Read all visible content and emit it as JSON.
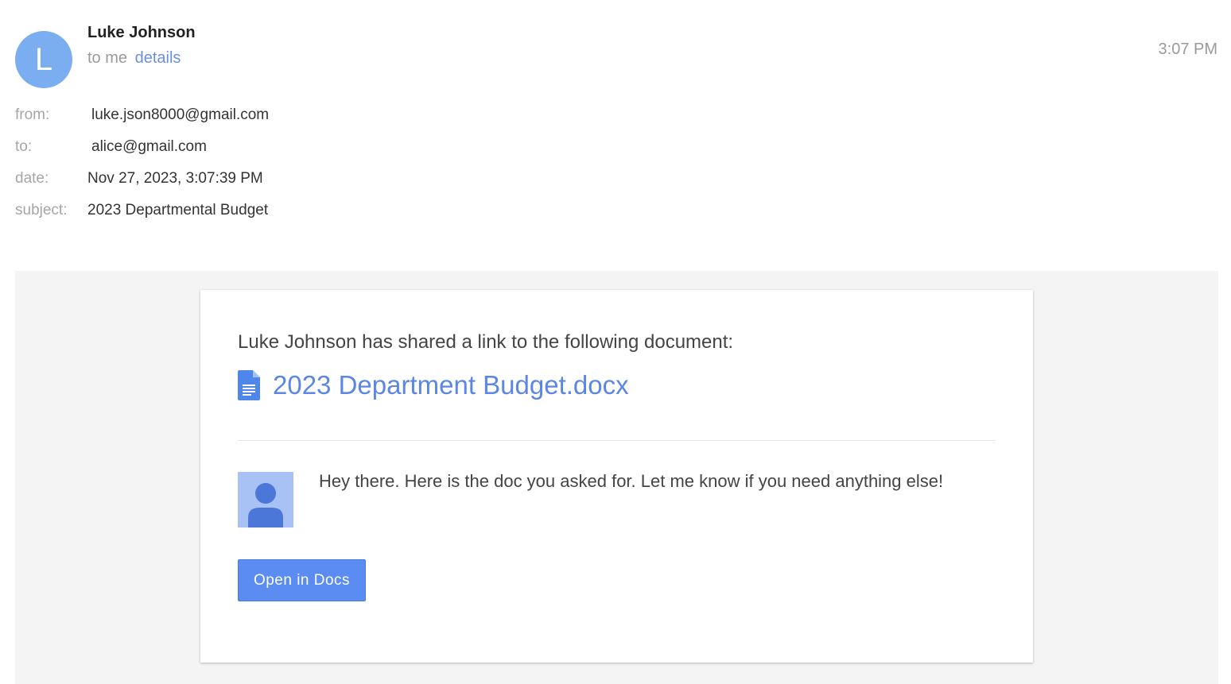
{
  "header": {
    "avatar_letter": "L",
    "sender_name": "Luke Johnson",
    "recipient_text": "to me",
    "details_link": "details",
    "time": "3:07 PM"
  },
  "meta": {
    "from_label": "from:",
    "from_value": "luke.json8000@gmail.com",
    "to_label": "to:",
    "to_value": "alice@gmail.com",
    "date_label": "date:",
    "date_value": "Nov 27, 2023, 3:07:39 PM",
    "subject_label": "subject:",
    "subject_value": "2023 Departmental Budget"
  },
  "card": {
    "share_text": "Luke Johnson has shared a link to the following document:",
    "doc_icon": "google-docs-icon",
    "doc_name": "2023 Department Budget.docx",
    "message": "Hey there. Here is the doc you asked for. Let me know if you need anything else!",
    "open_button_label": "Open in Docs"
  },
  "colors": {
    "avatar": "#7aaef0",
    "link": "#5b86e5",
    "button": "#5a8cf2",
    "body_bg": "#f4f4f4"
  }
}
